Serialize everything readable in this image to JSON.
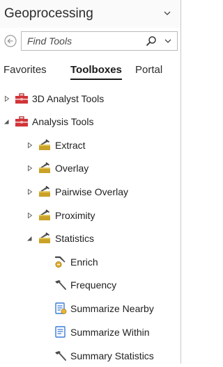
{
  "header": {
    "title": "Geoprocessing",
    "menu_icon": "chevron-down-icon"
  },
  "search": {
    "placeholder": "Find Tools",
    "back_icon": "back-arrow-icon",
    "search_icon": "search-icon",
    "options_icon": "chevron-down-icon"
  },
  "tabs": [
    {
      "label": "Favorites",
      "active": false
    },
    {
      "label": "Toolboxes",
      "active": true
    },
    {
      "label": "Portal",
      "active": false
    }
  ],
  "tree": [
    {
      "label": "3D Analyst Tools",
      "icon": "toolbox-icon",
      "expander": "collapsed"
    },
    {
      "label": "Analysis Tools",
      "icon": "toolbox-icon",
      "expander": "expanded"
    },
    {
      "label": "Extract",
      "icon": "toolset-icon",
      "expander": "collapsed"
    },
    {
      "label": "Overlay",
      "icon": "toolset-icon",
      "expander": "collapsed"
    },
    {
      "label": "Pairwise Overlay",
      "icon": "toolset-icon",
      "expander": "collapsed"
    },
    {
      "label": "Proximity",
      "icon": "toolset-icon",
      "expander": "collapsed"
    },
    {
      "label": "Statistics",
      "icon": "toolset-icon",
      "expander": "expanded"
    },
    {
      "label": "Enrich",
      "icon": "enrich-tool-icon"
    },
    {
      "label": "Frequency",
      "icon": "hammer-tool-icon"
    },
    {
      "label": "Summarize Nearby",
      "icon": "script-tool-icon"
    },
    {
      "label": "Summarize Within",
      "icon": "script-tool-icon"
    },
    {
      "label": "Summary Statistics",
      "icon": "hammer-tool-icon"
    }
  ],
  "colors": {
    "toolbox_red": "#d13438",
    "toolset_gold": "#c9a227",
    "script_blue": "#3a7bd5"
  }
}
